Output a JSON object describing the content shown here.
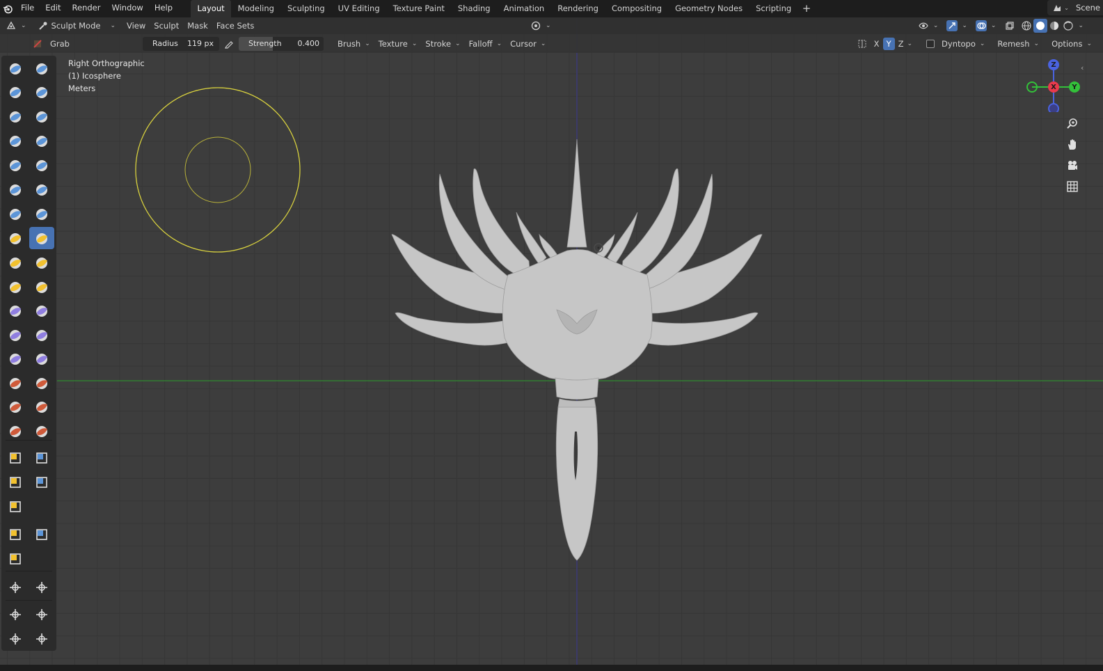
{
  "menubar": {
    "items": [
      "File",
      "Edit",
      "Render",
      "Window",
      "Help"
    ],
    "workspaces": [
      "Layout",
      "Modeling",
      "Sculpting",
      "UV Editing",
      "Texture Paint",
      "Shading",
      "Animation",
      "Rendering",
      "Compositing",
      "Geometry Nodes",
      "Scripting"
    ],
    "active_workspace": "Layout",
    "add_tab": "+",
    "scene_label": "Scene"
  },
  "header": {
    "mode": "Sculpt Mode",
    "menus": [
      "View",
      "Sculpt",
      "Mask",
      "Face Sets"
    ]
  },
  "tool_settings": {
    "brush_name": "Grab",
    "radius_label": "Radius",
    "radius_value": "119 px",
    "strength_label": "Strength",
    "strength_value": "0.400",
    "dropdowns": [
      "Brush",
      "Texture",
      "Stroke",
      "Falloff",
      "Cursor"
    ],
    "symmetry": [
      "X",
      "Y",
      "Z"
    ],
    "dyntopo": "Dyntopo",
    "remesh": "Remesh",
    "options": "Options"
  },
  "viewport": {
    "view_name": "Right Orthographic",
    "object_name": "(1) Icosphere",
    "units": "Meters"
  },
  "gizmo": {
    "z": "Z",
    "x": "X",
    "y": "Y"
  },
  "colors": {
    "accent": "#4772b3",
    "axis_x": "#e83a4c",
    "axis_y": "#33c13a",
    "axis_z": "#4a63e0",
    "brush_circle": "#d9d23e",
    "horizon_line": "#2f8c2f",
    "vertical_line": "#3c3a86",
    "mesh": "#c7c7c7"
  }
}
